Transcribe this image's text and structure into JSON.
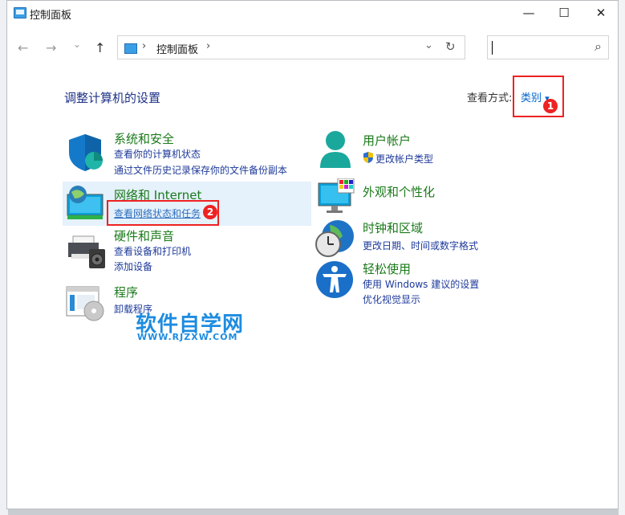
{
  "window": {
    "title": "控制面板",
    "minimize": "—",
    "maximize": "☐",
    "close": "✕"
  },
  "nav": {
    "back": "←",
    "forward": "→",
    "history": "⌄",
    "up": "↑"
  },
  "address": {
    "crumb": "控制面板",
    "sep1": "›",
    "sep2": "›",
    "dropdown": "⌄",
    "refresh": "↻"
  },
  "search": {
    "icon": "⌕"
  },
  "page": {
    "heading": "调整计算机的设置",
    "view_by_label": "查看方式:",
    "view_by_value": "类别",
    "view_by_arrow": "▾"
  },
  "badges": [
    "1",
    "2"
  ],
  "categories": {
    "system": {
      "title": "系统和安全",
      "links": [
        "查看你的计算机状态",
        "通过文件历史记录保存你的文件备份副本"
      ]
    },
    "network": {
      "title": "网络和 Internet",
      "links": [
        "查看网络状态和任务"
      ]
    },
    "hardware": {
      "title": "硬件和声音",
      "links": [
        "查看设备和打印机",
        "添加设备"
      ]
    },
    "programs": {
      "title": "程序",
      "links": [
        "卸载程序"
      ]
    },
    "user": {
      "title": "用户帐户",
      "links": [
        "更改帐户类型"
      ]
    },
    "appearance": {
      "title": "外观和个性化",
      "links": []
    },
    "clock": {
      "title": "时钟和区域",
      "links": [
        "更改日期、时间或数字格式"
      ]
    },
    "ease": {
      "title": "轻松使用",
      "links": [
        "使用 Windows 建议的设置",
        "优化视觉显示"
      ]
    }
  },
  "watermark": {
    "main": "软件自学网",
    "url": "WWW.RJZXW.COM"
  }
}
